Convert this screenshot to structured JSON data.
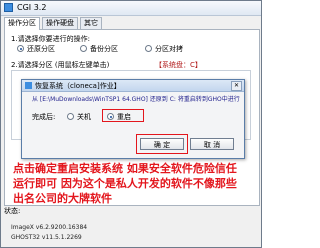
{
  "window": {
    "title": "CGI 3.2"
  },
  "tabs": [
    {
      "label": "操作分区",
      "active": true
    },
    {
      "label": "操作硬盘",
      "active": false
    },
    {
      "label": "其它",
      "active": false
    }
  ],
  "section1": {
    "label": "1.请选择你要进行的操作:",
    "options": [
      {
        "label": "还原分区",
        "selected": true
      },
      {
        "label": "备份分区",
        "selected": false
      },
      {
        "label": "分区对拷",
        "selected": false
      }
    ]
  },
  "section2": {
    "label": "2.请选择分区 (用鼠标左键单击)",
    "hint": "【系统盘：C】"
  },
  "modal": {
    "title": "恢复系统（cloneca]作业】",
    "path_text": "从 [E:\\MuDownloads\\WinTSP1 64.GHO] 还原到 C: 将重启转到GHO中进行",
    "finish_label": "完成后:",
    "options": [
      {
        "label": "关机",
        "selected": false
      },
      {
        "label": "重启",
        "selected": true
      }
    ],
    "ok_label": "确 定",
    "cancel_label": "取 消"
  },
  "annotation": {
    "line1": "点击确定重启安装系统  如果安全软件危险信任",
    "line2": "运行即可  因为这个是私人开发的软件不像那些",
    "line3": "出名公司的大牌软件"
  },
  "status": {
    "label": "状态:",
    "image_x": "ImageX v6.2.9200.16384",
    "ghost": "GHOST32 v11.5.1.2269"
  },
  "colors": {
    "accent": "#3c8de0",
    "annotation": "#e3161d"
  }
}
